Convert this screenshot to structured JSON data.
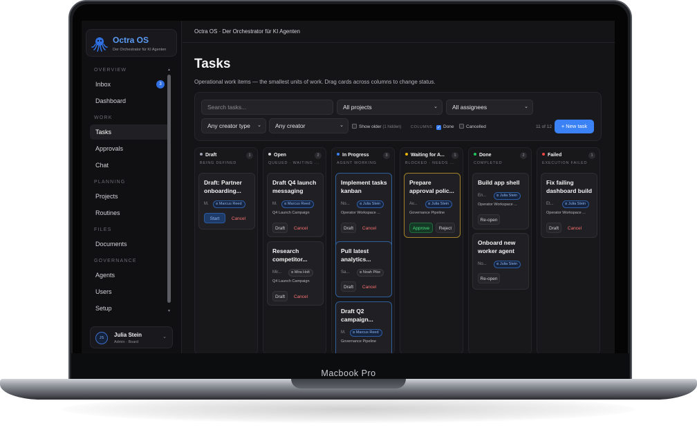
{
  "device": {
    "label": "Macbook Pro"
  },
  "brand": {
    "name": "Octra OS",
    "tagline": "Der Orchestrator für KI Agenten",
    "logo_icon": "octopus-icon",
    "accent": "#3b82f6"
  },
  "sidebar": {
    "sections": [
      {
        "title": "OVERVIEW",
        "items": [
          {
            "label": "Inbox",
            "badge": "3"
          },
          {
            "label": "Dashboard"
          }
        ]
      },
      {
        "title": "WORK",
        "items": [
          {
            "label": "Tasks",
            "active": true
          },
          {
            "label": "Approvals"
          },
          {
            "label": "Chat"
          }
        ]
      },
      {
        "title": "PLANNING",
        "items": [
          {
            "label": "Projects"
          },
          {
            "label": "Routines"
          }
        ]
      },
      {
        "title": "FILES",
        "items": [
          {
            "label": "Documents"
          }
        ]
      },
      {
        "title": "GOVERNANCE",
        "items": [
          {
            "label": "Agents"
          },
          {
            "label": "Users"
          },
          {
            "label": "Setup"
          }
        ]
      }
    ],
    "user": {
      "initials": "JS",
      "name": "Julia Stein",
      "role": "Admin · Board"
    }
  },
  "topbar": {
    "title": "Octra OS · Der Orchestrator für KI Agenten"
  },
  "page": {
    "title": "Tasks",
    "subtitle": "Operational work items — the smallest units of work. Drag cards across columns to change status."
  },
  "filters": {
    "search_placeholder": "Search tasks...",
    "project": "All projects",
    "assignee": "All assignees",
    "creator_type": "Any creator type",
    "creator": "Any creator",
    "show_older": {
      "label": "Show older",
      "hint": "(1 hidden)",
      "checked": false
    },
    "columns_label": "COLUMNS",
    "done": {
      "label": "Done",
      "checked": true
    },
    "cancelled": {
      "label": "Cancelled",
      "checked": false
    },
    "count": "11 of 12",
    "new_task": "+ New task"
  },
  "columns": [
    {
      "title": "Draft",
      "sub": "BEING DEFINED",
      "count": "1",
      "color": "#9ca3af",
      "cards": [
        {
          "title1": "Draft: Partner",
          "title2": "onboarding...",
          "meta": "M.",
          "assignee": "Marcus Reed",
          "actions": [
            "Start",
            "Cancel"
          ]
        }
      ]
    },
    {
      "title": "Open",
      "sub": "QUEUED · WAITING ...",
      "count": "2",
      "color": "#d4d4d8",
      "cards": [
        {
          "title1": "Draft Q4 launch",
          "title2": "messaging",
          "meta": "M.",
          "assignee": "Marcus Reed",
          "project": "Q4 Launch Campaign",
          "actions": [
            "Draft",
            "Cancel"
          ]
        },
        {
          "title1": "Research",
          "title2": "competitor...",
          "meta": "Mir...",
          "assignee": "Mira Holt",
          "project": "Q4 Launch Campaign",
          "actions": [
            "Draft",
            "Cancel"
          ]
        }
      ]
    },
    {
      "title": "In Progress",
      "sub": "AGENT WORKING",
      "count": "3",
      "color": "#3b82f6",
      "cards": [
        {
          "title1": "Implement tasks",
          "title2": "kanban",
          "meta": "No...",
          "assignee": "Julia Stein",
          "project": "Operator Workspace ...",
          "actions": [
            "Draft",
            "Cancel"
          ]
        },
        {
          "title1": "Pull latest",
          "title2": "analytics...",
          "meta": "Sa...",
          "assignee": "Noah Pike",
          "actions": [
            "Draft",
            "Cancel"
          ]
        },
        {
          "title1": "Draft Q2",
          "title2": "campaign...",
          "meta": "M.",
          "assignee": "Marcus Reed",
          "project": "Governance Pipeline"
        }
      ]
    },
    {
      "title": "Waiting for A...",
      "sub": "BLOCKED · NEEDS ...",
      "count": "1",
      "color": "#eab308",
      "cards": [
        {
          "title1": "Prepare",
          "title2": "approval polic...",
          "meta": "Av...",
          "assignee": "Julia Stein",
          "project": "Governance Pipeline",
          "actions": [
            "Approve",
            "Reject"
          ]
        }
      ]
    },
    {
      "title": "Done",
      "sub": "COMPLETED",
      "count": "2",
      "color": "#22c55e",
      "cards": [
        {
          "title1": "Build app shell",
          "title2": "",
          "meta": "En...",
          "assignee": "Julia Stein",
          "project": "Operator Workspace ...",
          "actions": [
            "Re-open"
          ]
        },
        {
          "title1": "Onboard new",
          "title2": "worker agent",
          "meta": "No...",
          "assignee": "Julia Stein",
          "actions": [
            "Re-open"
          ]
        }
      ]
    },
    {
      "title": "Failed",
      "sub": "EXECUTION FAILED",
      "count": "1",
      "color": "#ef4444",
      "cards": [
        {
          "title1": "Fix failing",
          "title2": "dashboard build",
          "meta": "Et...",
          "assignee": "Julia Stein",
          "project": "Operator Workspace ...",
          "actions": [
            "Draft",
            "Cancel"
          ]
        }
      ]
    }
  ]
}
